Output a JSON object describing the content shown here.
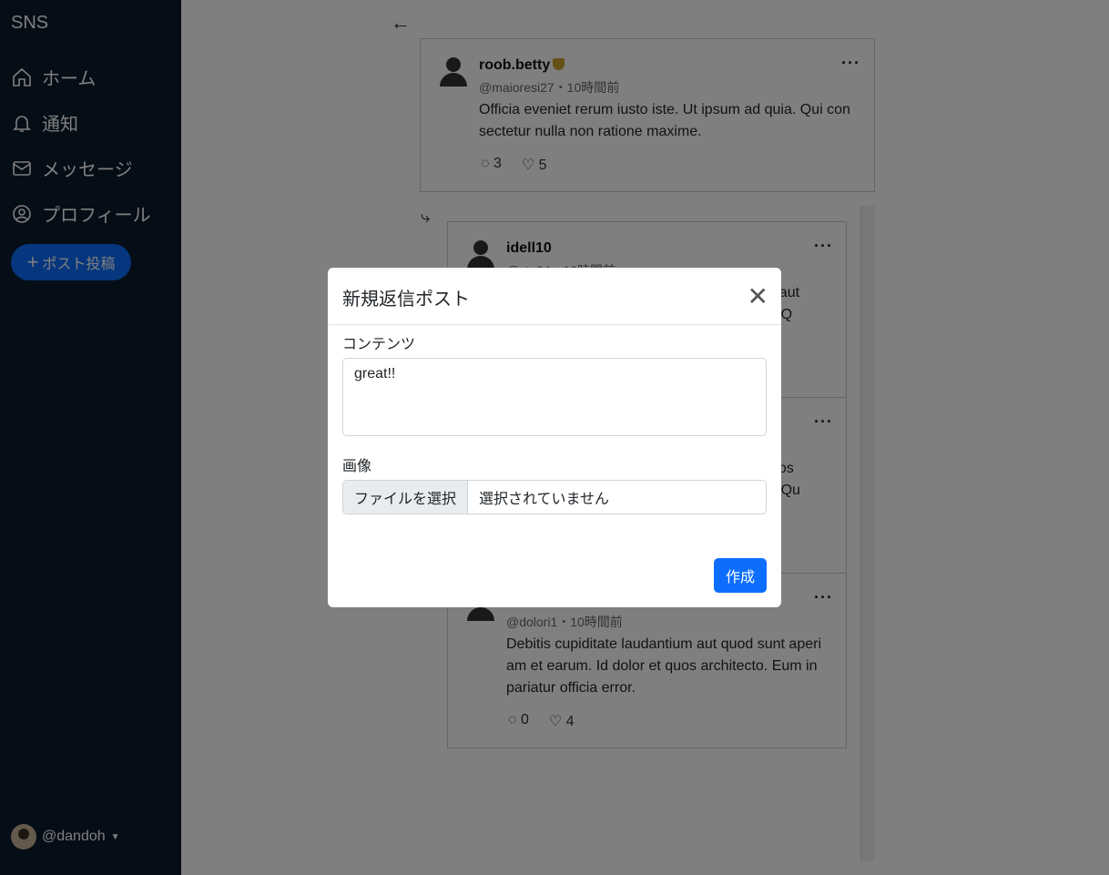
{
  "sidebar": {
    "brand": "SNS",
    "items": [
      {
        "label": "ホーム",
        "icon": "home-icon"
      },
      {
        "label": "通知",
        "icon": "bell-icon"
      },
      {
        "label": "メッセージ",
        "icon": "envelope-icon"
      },
      {
        "label": "プロフィール",
        "icon": "person-circle-icon"
      }
    ],
    "post_button": "ポスト投稿",
    "user": "@dandoh"
  },
  "main": {
    "posts": [
      {
        "name": "roob.betty",
        "handle": "@maioresi27・10時間前",
        "text": "Officia eveniet rerum iusto iste. Ut ipsum ad quia. Qui con sectetur nulla non ratione maxime.",
        "replies": "3",
        "likes": "5"
      },
      {
        "name": "idell10",
        "handle": "@stu34・10時間前",
        "text_right": "ctus aut\nque. Q\nd."
      },
      {
        "text_right": "ssimos\ntem. Qu"
      },
      {
        "handle": "@dolori1・10時間前",
        "text": "Debitis cupiditate laudantium aut quod sunt aperi am et earum. Id dolor et quos architecto. Eum in pariatur officia error.",
        "replies": "0",
        "likes": "4"
      }
    ]
  },
  "modal": {
    "title": "新規返信ポスト",
    "content_label": "コンテンツ",
    "content_value": "great!!",
    "image_label": "画像",
    "file_button": "ファイルを選択",
    "file_status": "選択されていません",
    "submit": "作成"
  }
}
